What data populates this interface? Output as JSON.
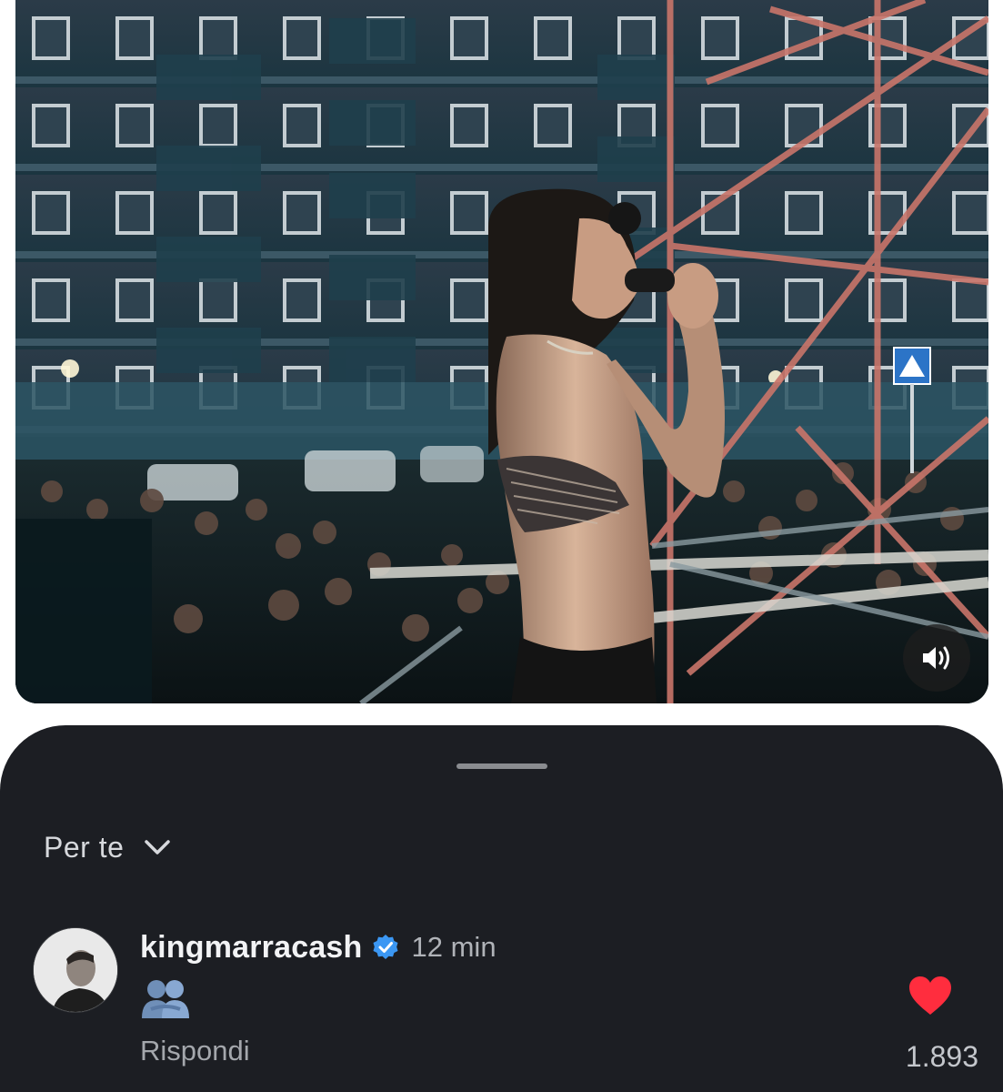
{
  "video": {
    "sound_icon": "speaker-volume-icon",
    "accent_colors": {
      "sky": "#0b2b33",
      "building": "#1a3a45",
      "scaffold": "#c9756a"
    }
  },
  "sheet": {
    "feed_label": "Per te",
    "feed_dropdown_icon": "chevron-down-icon"
  },
  "comment": {
    "username": "kingmarracash",
    "verified_icon": "verified-badge-icon",
    "timestamp": "12 min",
    "body_icon": "people-hugging-emoji",
    "reply_label": "Rispondi",
    "like_icon": "heart-filled-icon",
    "like_color": "#ff2d3e",
    "like_count": "1.893"
  }
}
